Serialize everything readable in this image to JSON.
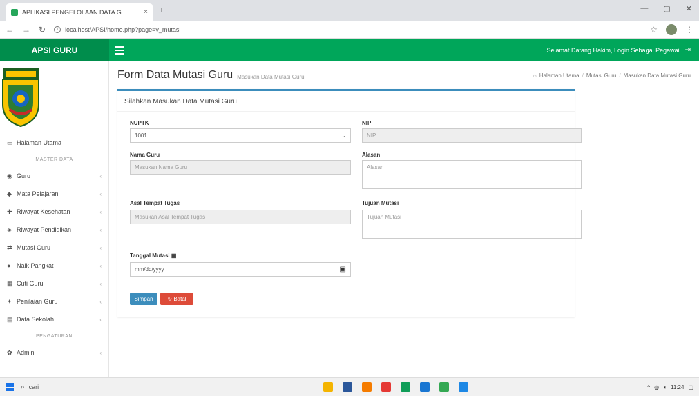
{
  "browser": {
    "tab_title": "APLIKASI PENGELOLAAN DATA G",
    "tab_close": "×",
    "new_tab": "+",
    "url": "localhost/APSI/home.php?page=v_mutasi",
    "controls": {
      "minimize": "—",
      "maximize": "▢",
      "close": "✕"
    }
  },
  "app": {
    "brand": "APSI GURU",
    "welcome": "Selamat Datang Hakim, Login Sebagai Pegawai",
    "signout_icon": "⇥",
    "accent": "#00a65a",
    "primary": "#3c8dbc",
    "danger": "#dd4b39"
  },
  "sidebar": {
    "items_top": [
      {
        "icon": "▭",
        "label": "Halaman Utama",
        "chevron": ""
      }
    ],
    "header_master": "MASTER DATA",
    "items_master": [
      {
        "icon": "◉",
        "label": "Guru",
        "chevron": "‹"
      },
      {
        "icon": "◆",
        "label": "Mata Pelajaran",
        "chevron": "‹"
      },
      {
        "icon": "✚",
        "label": "Riwayat Kesehatan",
        "chevron": "‹"
      },
      {
        "icon": "◈",
        "label": "Riwayat Pendidikan",
        "chevron": "‹"
      },
      {
        "icon": "⇄",
        "label": "Mutasi Guru",
        "chevron": "‹"
      },
      {
        "icon": "●",
        "label": "Naik Pangkat",
        "chevron": "‹"
      },
      {
        "icon": "▦",
        "label": "Cuti Guru",
        "chevron": "‹"
      },
      {
        "icon": "✦",
        "label": "Penilaian Guru",
        "chevron": "‹"
      },
      {
        "icon": "▤",
        "label": "Data Sekolah",
        "chevron": "‹"
      }
    ],
    "header_pengaturan": "PENGATURAN",
    "items_pengaturan": [
      {
        "icon": "✿",
        "label": "Admin",
        "chevron": "‹"
      }
    ]
  },
  "content": {
    "title": "Form Data Mutasi Guru",
    "subtitle": "Masukan Data Mutasi Guru",
    "breadcrumb": [
      "Halaman Utama",
      "Mutasi Guru",
      "Masukan Data Mutasi Guru"
    ],
    "box_title": "Silahkan Masukan Data Mutasi Guru",
    "fields": {
      "nuptk": {
        "label": "NUPTK",
        "value": "1001"
      },
      "nip": {
        "label": "NIP",
        "placeholder": "NIP"
      },
      "nama": {
        "label": "Nama Guru",
        "placeholder": "Masukan Nama Guru"
      },
      "alasan": {
        "label": "Alasan",
        "placeholder": "Alasan"
      },
      "asal": {
        "label": "Asal Tempat Tugas",
        "placeholder": "Masukan Asal Tempat Tugas"
      },
      "tujuan": {
        "label": "Tujuan Mutasi",
        "placeholder": "Tujuan Mutasi"
      },
      "tanggal": {
        "label": "Tanggal Mutasi",
        "placeholder": "mm/dd/yyyy"
      }
    },
    "btn_save": "Simpan",
    "btn_reset": "Batal"
  },
  "taskbar": {
    "search_text": "cari",
    "time": "11:24"
  }
}
